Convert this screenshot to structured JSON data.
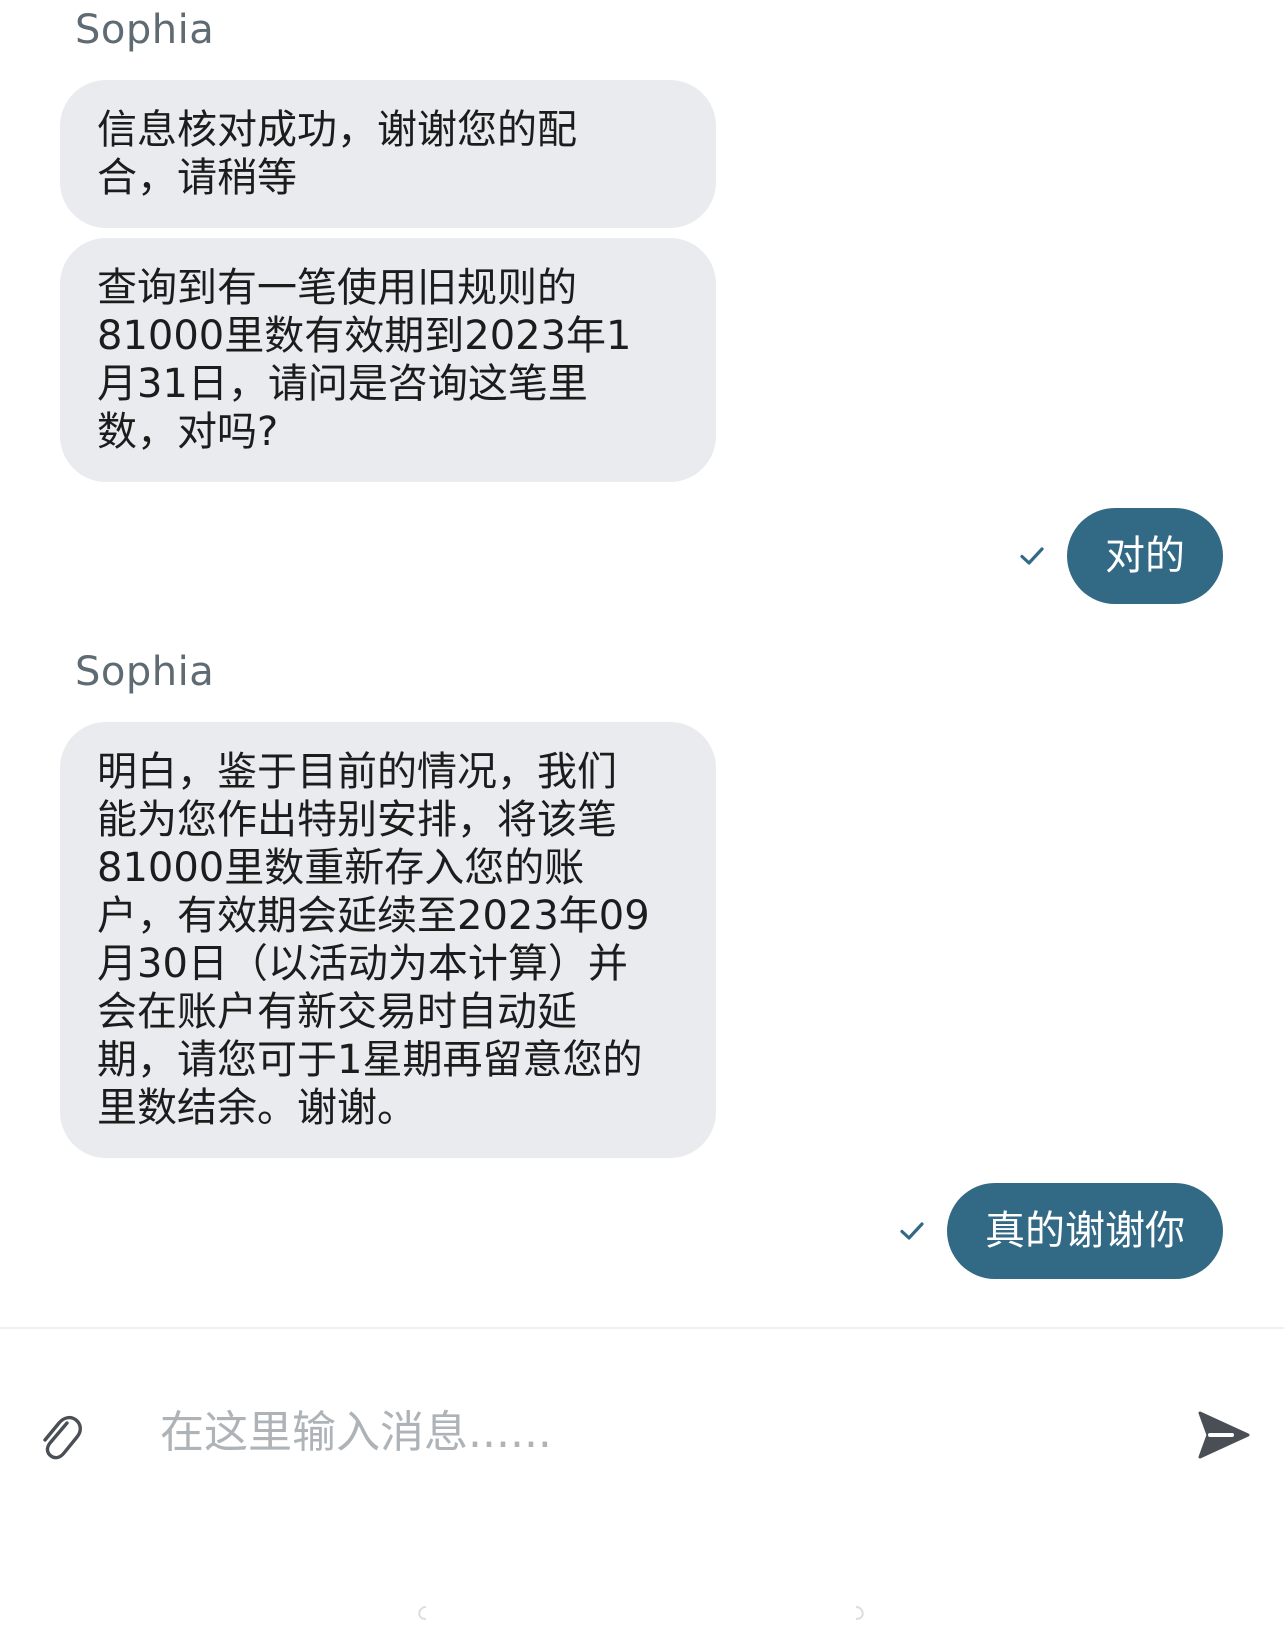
{
  "conversation": {
    "messages": [
      {
        "type": "name",
        "text": "Sophia"
      },
      {
        "type": "in",
        "text": "信息核对成功，谢谢您的配\n合，请稍等"
      },
      {
        "type": "in",
        "text": "查询到有一笔使用旧规则的\n81000里数有效期到2023年1\n月31日，请问是咨询这笔里\n数，对吗?"
      },
      {
        "type": "out",
        "text": "对的"
      },
      {
        "type": "name",
        "text": "Sophia"
      },
      {
        "type": "in",
        "text": "明白，鉴于目前的情况，我们\n能为您作出特别安排，将该笔\n81000里数重新存入您的账\n户，有效期会延续至2023年09\n月30日（以活动为本计算）并\n会在账户有新交易时自动延\n期，请您可于1星期再留意您的\n里数结余。谢谢。"
      },
      {
        "type": "out",
        "text": "真的谢谢你"
      }
    ]
  },
  "composer": {
    "placeholder": "在这里输入消息......",
    "value": "",
    "attach_icon": "paperclip-icon",
    "send_icon": "send-arrow-icon"
  },
  "colors": {
    "outgoing_bubble": "#326a86",
    "incoming_bubble": "#e9ebee",
    "check": "#326a86",
    "send_icon": "#4a4f55"
  }
}
